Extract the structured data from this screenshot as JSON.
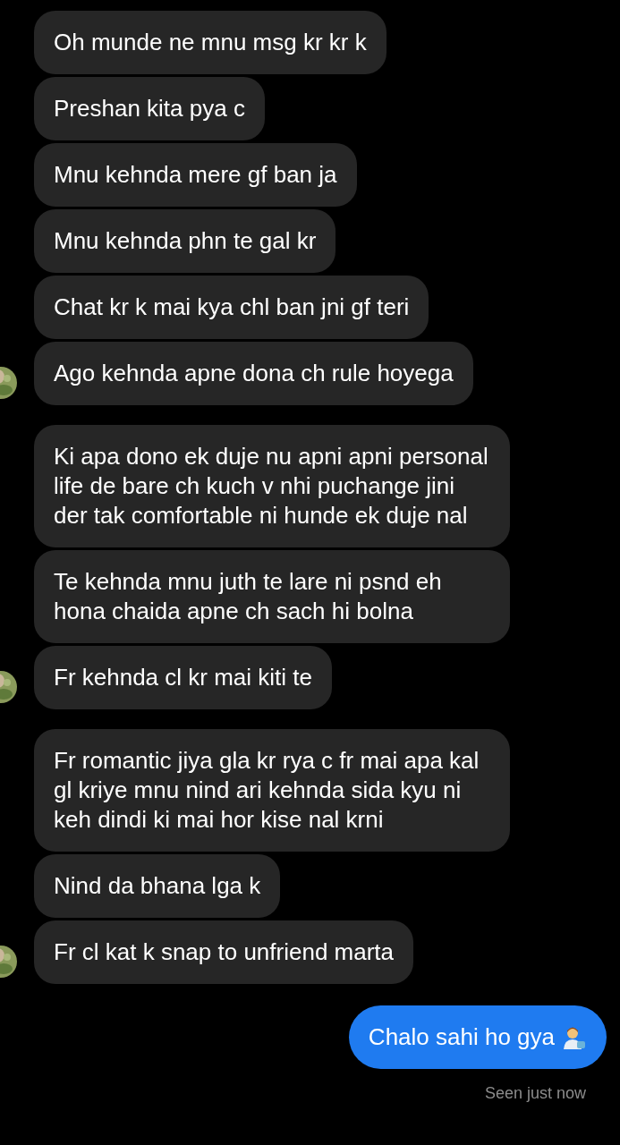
{
  "messages": [
    {
      "text": "Oh munde ne mnu msg kr kr k",
      "avatar": false
    },
    {
      "text": "Preshan kita pya c",
      "avatar": false
    },
    {
      "text": "Mnu kehnda mere gf ban ja",
      "avatar": false
    },
    {
      "text": "Mnu kehnda phn te gal kr",
      "avatar": false
    },
    {
      "text": "Chat kr k mai kya chl ban jni gf teri",
      "avatar": false
    },
    {
      "text": "Ago kehnda apne dona ch rule hoyega",
      "avatar": true
    },
    {
      "text": "Ki apa dono ek duje nu apni apni personal life de bare ch kuch v nhi puchange jini der tak comfortable ni hunde ek duje nal",
      "avatar": false
    },
    {
      "text": "Te kehnda mnu juth te lare ni psnd eh hona chaida apne ch sach hi bolna",
      "avatar": false
    },
    {
      "text": "Fr kehnda cl kr mai kiti te",
      "avatar": true
    },
    {
      "text": "Fr romantic jiya gla kr rya c  fr mai apa kal gl kriye mnu nind ari kehnda sida kyu ni keh dindi ki mai hor kise nal krni",
      "avatar": false
    },
    {
      "text": "Nind da bhana lga k",
      "avatar": false
    },
    {
      "text": "Fr cl kat k snap to unfriend marta",
      "avatar": true
    }
  ],
  "sent": {
    "text": "Chalo sahi ho gya"
  },
  "receipt": "Seen just now"
}
